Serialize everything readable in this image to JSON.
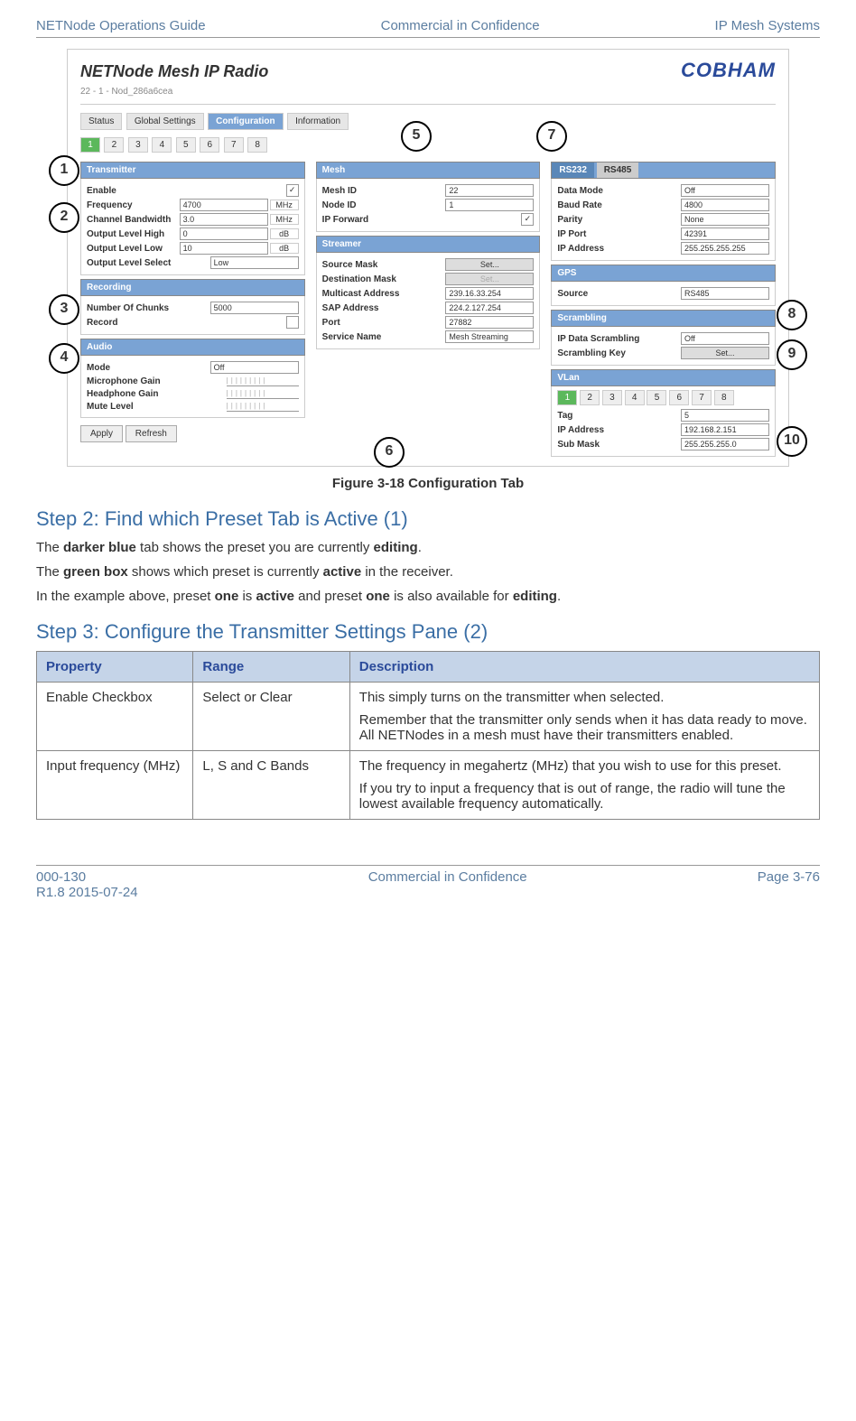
{
  "header": {
    "left": "NETNode Operations Guide",
    "center": "Commercial in Confidence",
    "right": "IP Mesh Systems"
  },
  "footer": {
    "left1": "000-130",
    "left2": "R1.8 2015-07-24",
    "center": "Commercial in Confidence",
    "right": "Page 3-76"
  },
  "figure": {
    "appTitle": "NETNode Mesh IP Radio",
    "brand": "COBHAM",
    "breadcrumb": "22 - 1 - Nod_286a6cea",
    "topTabs": [
      "Status",
      "Global Settings",
      "Configuration",
      "Information"
    ],
    "activeTopTab": "Configuration",
    "presetTabs": [
      "1",
      "2",
      "3",
      "4",
      "5",
      "6",
      "7",
      "8"
    ],
    "activePreset": "1",
    "transmitter": {
      "title": "Transmitter",
      "enable": "✓",
      "frequency": "4700",
      "frequencyUnit": "MHz",
      "bandwidth": "3.0",
      "bandwidthUnit": "MHz",
      "outHigh": "0",
      "outHighUnit": "dB",
      "outLow": "10",
      "outLowUnit": "dB",
      "outSelect": "Low"
    },
    "recording": {
      "title": "Recording",
      "chunks": "5000",
      "record": ""
    },
    "audio": {
      "title": "Audio",
      "mode": "Off",
      "micGain": "",
      "hpGain": "",
      "mute": ""
    },
    "mesh": {
      "title": "Mesh",
      "meshId": "22",
      "nodeId": "1",
      "ipForward": "✓"
    },
    "streamer": {
      "title": "Streamer",
      "sourceMask": "Set...",
      "destMask": "Set...",
      "multicast": "239.16.33.254",
      "sap": "224.2.127.254",
      "port": "27882",
      "service": "Mesh Streaming"
    },
    "rs232": {
      "title": "RS232",
      "tab2": "RS485",
      "dataMode": "Off",
      "baud": "4800",
      "parity": "None",
      "ipPort": "42391",
      "ipAddr": "255.255.255.255"
    },
    "gps": {
      "title": "GPS",
      "source": "RS485"
    },
    "scrambling": {
      "title": "Scrambling",
      "ipData": "Off",
      "key": "Set..."
    },
    "vlan": {
      "title": "VLan",
      "tabs": [
        "1",
        "2",
        "3",
        "4",
        "5",
        "6",
        "7",
        "8"
      ],
      "tag": "5",
      "ipAddr": "192.168.2.151",
      "subMask": "255.255.255.0"
    },
    "buttons": {
      "apply": "Apply",
      "refresh": "Refresh"
    },
    "callouts": {
      "1": "1",
      "2": "2",
      "3": "3",
      "4": "4",
      "5": "5",
      "6": "6",
      "7": "7",
      "8": "8",
      "9": "9",
      "10": "10"
    }
  },
  "caption": "Figure 3-18 Configuration Tab",
  "step2": {
    "heading": "Step 2: Find which Preset Tab is Active (1)",
    "p1a": "The ",
    "p1b": "darker blue",
    "p1c": " tab shows the preset you are currently ",
    "p1d": "editing",
    "p1e": ".",
    "p2a": "The ",
    "p2b": "green box",
    "p2c": " shows which preset is currently ",
    "p2d": "active",
    "p2e": " in the receiver.",
    "p3a": "In the example above, preset ",
    "p3b": "one",
    "p3c": " is ",
    "p3d": "active",
    "p3e": " and preset ",
    "p3f": "one",
    "p3g": " is also available for ",
    "p3h": "editing",
    "p3i": "."
  },
  "step3": {
    "heading": "Step 3: Configure the Transmitter Settings Pane (2)",
    "th1": "Property",
    "th2": "Range",
    "th3": "Description",
    "r1c1": "Enable Checkbox",
    "r1c2": "Select or Clear",
    "r1c3a": "This simply turns on the transmitter when selected.",
    "r1c3b": "Remember that the transmitter only sends when it has data ready to move. All NETNodes in a mesh must have their transmitters enabled.",
    "r2c1": "Input frequency (MHz)",
    "r2c2": "L, S and C Bands",
    "r2c3a": "The frequency in megahertz (MHz) that you wish to use for this preset.",
    "r2c3b": "If you try to input a frequency that is out of range, the radio will tune the lowest available frequency automatically."
  },
  "labels": {
    "enable": "Enable",
    "frequency": "Frequency",
    "bandwidth": "Channel Bandwidth",
    "outHigh": "Output Level High",
    "outLow": "Output Level Low",
    "outSelect": "Output Level Select",
    "chunks": "Number Of Chunks",
    "record": "Record",
    "mode": "Mode",
    "micGain": "Microphone Gain",
    "hpGain": "Headphone Gain",
    "mute": "Mute Level",
    "meshId": "Mesh ID",
    "nodeId": "Node ID",
    "ipForward": "IP Forward",
    "sourceMask": "Source Mask",
    "destMask": "Destination Mask",
    "multicast": "Multicast Address",
    "sap": "SAP Address",
    "port": "Port",
    "service": "Service Name",
    "dataMode": "Data Mode",
    "baud": "Baud Rate",
    "parity": "Parity",
    "ipPort": "IP Port",
    "ipAddr": "IP Address",
    "source": "Source",
    "ipData": "IP Data Scrambling",
    "key": "Scrambling Key",
    "tag": "Tag",
    "subMask": "Sub Mask"
  }
}
